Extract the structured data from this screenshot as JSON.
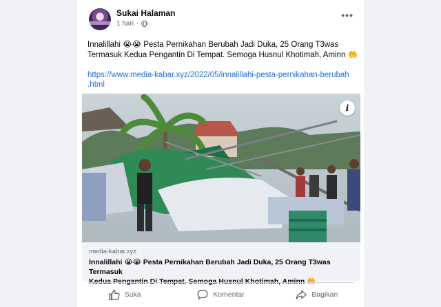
{
  "post": {
    "page_name": "Sukai Halaman",
    "time": "1 hari",
    "privacy_icon": "globe-icon",
    "more_icon": "more-options-icon",
    "more_label": "•••",
    "text_line1": "Innalillahi 😭😭 Pesta Pernikahan Berubah Jadi Duka, 25 Orang T3was",
    "text_line2": "Termasuk Kedua Pengantin Di Tempat. Semoga Husnul Khotimah, Aminn 🤲",
    "link_line1": "https://www.media-kabar.xyz/2022/05/innalillahi-pesta-pernikahan-berubah",
    "link_line2": ".html"
  },
  "link_preview": {
    "info_label": "i",
    "domain": "media-kabar.xyz",
    "title_line1": "Innalillahi 😭😭 Pesta Pernikahan Berubah Jadi Duka, 25 Orang T3was Termasuk",
    "title_line2": "Kedua Pengantin Di Tempat. Semoga Husnul Khotimah, Aminn 🤲"
  },
  "actions": {
    "like": "Suka",
    "comment": "Komentar",
    "share": "Bagikan"
  },
  "colors": {
    "link": "#216fdb",
    "secondary_text": "#65676b",
    "preview_bg": "#f0f2f5"
  }
}
